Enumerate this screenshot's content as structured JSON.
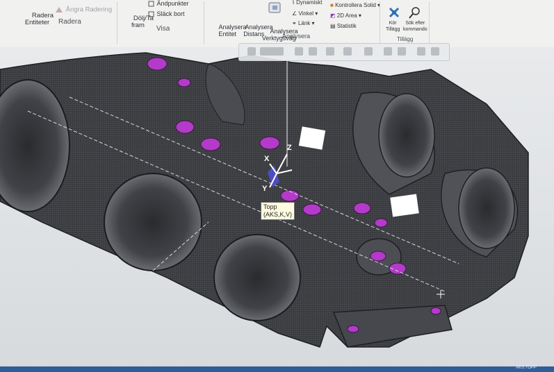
{
  "ribbon": {
    "radera": {
      "label": "Radera",
      "buttons": [
        {
          "label": "Radera\nEntiteter",
          "icon": "delete-entities-icon"
        },
        {
          "label": "Ångra Radering",
          "icon": "undo-delete-icon"
        }
      ]
    },
    "visa": {
      "label": "Visa",
      "buttons": [
        {
          "label": "Dölj/Ta\nfram",
          "icon": "hide-show-icon"
        },
        {
          "label": "Ändpunkter",
          "icon": "endpoints-icon"
        },
        {
          "label": "Släck bort",
          "icon": "blank-icon"
        }
      ]
    },
    "analysera": {
      "label": "Analysera",
      "large_buttons": [
        {
          "label": "Analysera\nEntitet",
          "icon": "analyze-entity-icon"
        },
        {
          "label": "Analysera\nDistans",
          "icon": "analyze-distance-icon"
        },
        {
          "label": "Analysera\nVerktygsväg",
          "icon": "analyze-toolpath-icon"
        }
      ],
      "small_buttons": [
        {
          "label": "Dynamiskt",
          "icon": "dynamic-icon"
        },
        {
          "label": "Vinkel",
          "icon": "angle-icon"
        },
        {
          "label": "Länk",
          "icon": "link-icon"
        },
        {
          "label": "Kontrollera Solid",
          "icon": "check-solid-icon"
        },
        {
          "label": "2D Area",
          "icon": "area-2d-icon"
        },
        {
          "label": "Statistik",
          "icon": "statistics-icon"
        }
      ]
    },
    "tillagg": {
      "label": "Tillägg",
      "buttons": [
        {
          "label": "Kör\nTillägg",
          "icon": "run-addin-icon"
        },
        {
          "label": "Sök efter\nkommando",
          "icon": "search-command-icon"
        }
      ]
    }
  },
  "viewport": {
    "tooltip": "Topp\n(AKS,K,V)",
    "axes": {
      "x": "X",
      "y": "Y",
      "z": "Z"
    }
  },
  "status_bar": {
    "view": "AKS:TOPP"
  },
  "colors": {
    "part_body": "#3c3d41",
    "part_edge": "#1e1f22",
    "holes": "#b43ac9",
    "selection_plane": "#5050d8",
    "ribbon_bg": "#f1f1f0",
    "status_bar": "#2f5d98"
  }
}
